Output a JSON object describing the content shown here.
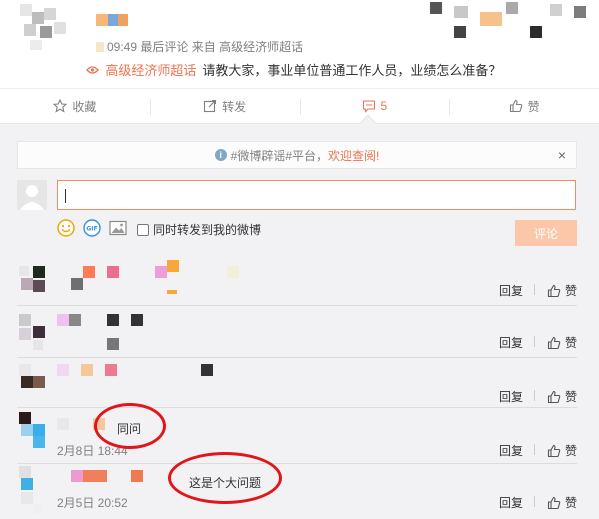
{
  "post": {
    "time": "09:49",
    "last_comment": "最后评论",
    "source_prefix": "来自",
    "source": "高级经济师超话",
    "topic": "高级经济师超话",
    "snippet": "请教大家，事业单位普通工作人员，业绩怎么准备？"
  },
  "actions": {
    "favorite": "收藏",
    "repost": "转发",
    "comment_count": "5",
    "like": "赞"
  },
  "notice": {
    "text": "#微博辟谣#平台，",
    "link": "欢迎查阅!",
    "close": "×"
  },
  "composer": {
    "input_value": "",
    "repost_option": "同时转发到我的微博",
    "submit": "评论"
  },
  "comment_actions": {
    "reply": "回复",
    "like": "赞"
  },
  "comments": [
    {
      "text": "",
      "time": ""
    },
    {
      "text": "",
      "time": ""
    },
    {
      "text": "",
      "time": ""
    },
    {
      "text": "同问",
      "time": "2月8日 18:44"
    },
    {
      "text": "这是个大问题",
      "time": "2月5日 20:52"
    }
  ],
  "colors": {
    "accent": "#eb7350",
    "annotation": "#e0161a",
    "submit_disabled": "#fbc7a8",
    "panel_bg": "#f2f2f5"
  }
}
